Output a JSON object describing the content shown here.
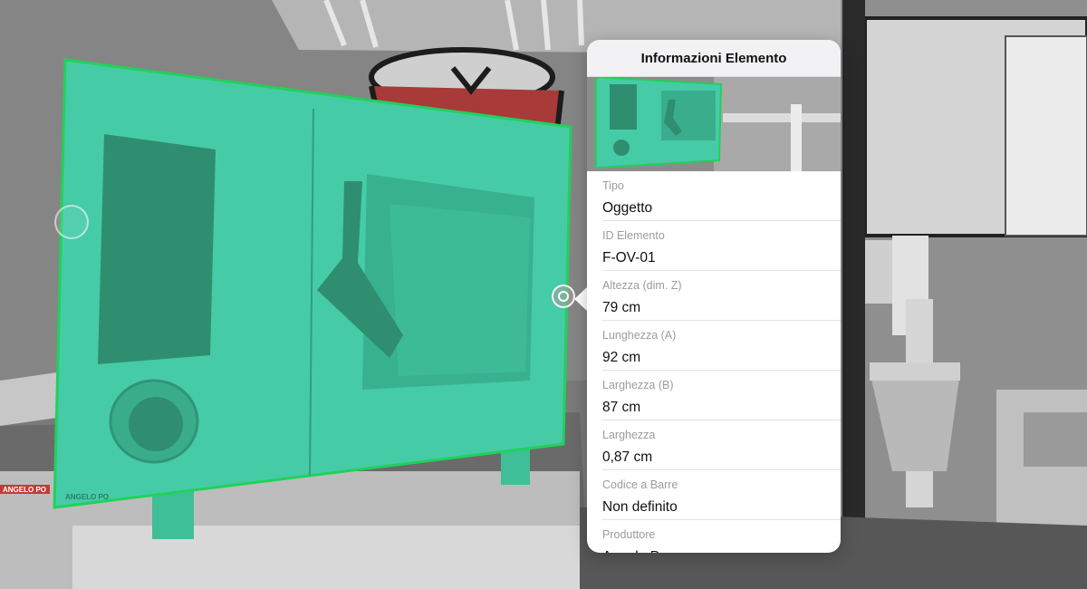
{
  "popover": {
    "title": "Informazioni Elemento",
    "fields": [
      {
        "label": "Tipo",
        "value": "Oggetto"
      },
      {
        "label": "ID Elemento",
        "value": "F-OV-01"
      },
      {
        "label": "Altezza (dim. Z)",
        "value": "79 cm"
      },
      {
        "label": "Lunghezza (A)",
        "value": "92 cm"
      },
      {
        "label": "Larghezza (B)",
        "value": "87 cm"
      },
      {
        "label": "Larghezza",
        "value": "0,87 cm"
      },
      {
        "label": "Codice a Barre",
        "value": "Non definito"
      },
      {
        "label": "Produttore",
        "value": "Angelo Po"
      }
    ]
  },
  "scene": {
    "brand_logo": "ANGELO PO",
    "brand_logo_left": "ANGELO PO",
    "highlight_color": "#46cba7",
    "outline_color": "#22d15a"
  }
}
